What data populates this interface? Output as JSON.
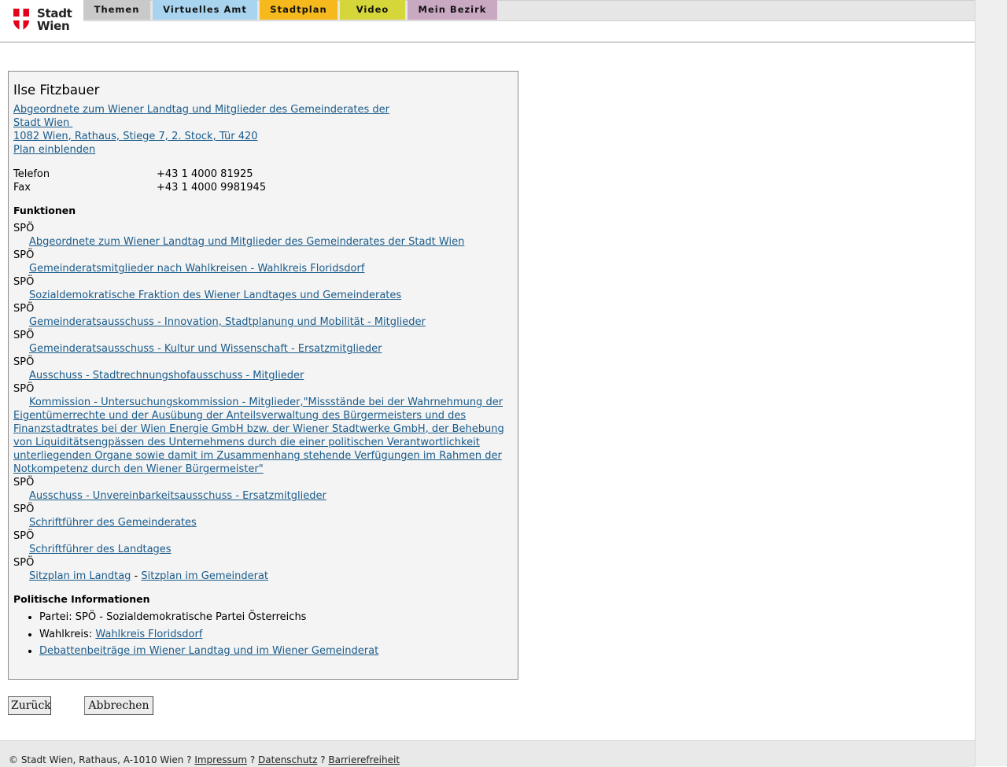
{
  "logo": {
    "line1": "Stadt",
    "line2": "Wien"
  },
  "nav": {
    "tabs": [
      {
        "label": "Themen",
        "color": "#c9c9c9"
      },
      {
        "label": "Virtuelles Amt",
        "color": "#a9d4ef"
      },
      {
        "label": "Stadtplan",
        "color": "#f5b91d"
      },
      {
        "label": "Video",
        "color": "#d5d63a"
      },
      {
        "label": "Mein Bezirk",
        "color": "#c9a9c2"
      }
    ]
  },
  "person": {
    "name": "Ilse Fitzbauer",
    "org_line1": "Abgeordnete zum Wiener Landtag und Mitglieder des Gemeinderates der",
    "org_line2": "Stadt Wien ",
    "address": "1082 Wien, Rathaus, Stiege 7, 2. Stock, Tür 420",
    "plan_link": "Plan einblenden",
    "contact": [
      {
        "label": "Telefon",
        "value": "+43 1 4000 81925"
      },
      {
        "label": "Fax",
        "value": "+43 1 4000 9981945"
      }
    ]
  },
  "funktionen": {
    "heading": "Funktionen",
    "items": [
      {
        "party": "SPÖ",
        "link": "Abgeordnete zum Wiener Landtag und Mitglieder des Gemeinderates der Stadt Wien"
      },
      {
        "party": "SPÖ",
        "link": "Gemeinderatsmitglieder nach Wahlkreisen - Wahlkreis Floridsdorf"
      },
      {
        "party": "SPÖ",
        "link": "Sozialdemokratische Fraktion des Wiener Landtages und Gemeinderates"
      },
      {
        "party": "SPÖ",
        "link": "Gemeinderatsausschuss - Innovation, Stadtplanung und Mobilität - Mitglieder"
      },
      {
        "party": "SPÖ",
        "link": "Gemeinderatsausschuss - Kultur und Wissenschaft - Ersatzmitglieder"
      },
      {
        "party": "SPÖ",
        "link": "Ausschuss - Stadtrechnungshofausschuss - Mitglieder"
      },
      {
        "party": "SPÖ",
        "link": "Kommission - Untersuchungskommission - Mitglieder,\"Missstände bei der Wahrnehmung der Eigentümerrechte und der Ausübung der Anteilsverwaltung des Bürgermeisters und des Finanzstadtrates bei der Wien Energie GmbH bzw. der Wiener Stadtwerke GmbH, der Behebung von Liquiditätsengpässen des Unternehmens durch die einer politischen Verantwortlichkeit unterliegenden Organe sowie damit im Zusammenhang stehende Verfügungen im Rahmen der Notkompetenz durch den Wiener Bürgermeister\""
      },
      {
        "party": "SPÖ",
        "link": "Ausschuss - Unvereinbarkeitsausschuss - Ersatzmitglieder"
      },
      {
        "party": "SPÖ",
        "link": "Schriftführer des Gemeinderates"
      },
      {
        "party": "SPÖ",
        "link": "Schriftführer des Landtages"
      }
    ],
    "last": {
      "party": "SPÖ",
      "link_a": "Sitzplan im Landtag",
      "sep": " - ",
      "link_b": "Sitzplan im Gemeinderat"
    }
  },
  "politisch": {
    "heading": "Politische Informationen",
    "partei_label": "Partei: ",
    "partei_value": "SPÖ - Sozialdemokratische Partei Österreichs",
    "wahlkreis_label": "Wahlkreis: ",
    "wahlkreis_link": "Wahlkreis Floridsdorf",
    "debatten_link": "Debattenbeiträge im Wiener Landtag und im Wiener Gemeinderat"
  },
  "buttons": {
    "back": "Zurück",
    "cancel": "Abbrechen"
  },
  "footer": {
    "copyright": "© Stadt Wien, Rathaus, A-1010 Wien ? ",
    "impressum": "Impressum",
    "sep1": " ? ",
    "datenschutz": "Datenschutz",
    "sep2": " ? ",
    "barrierefreiheit": "Barrierefreiheit"
  },
  "colors": {
    "link": "#1a5b8a",
    "logo_red": "#e2001a"
  }
}
